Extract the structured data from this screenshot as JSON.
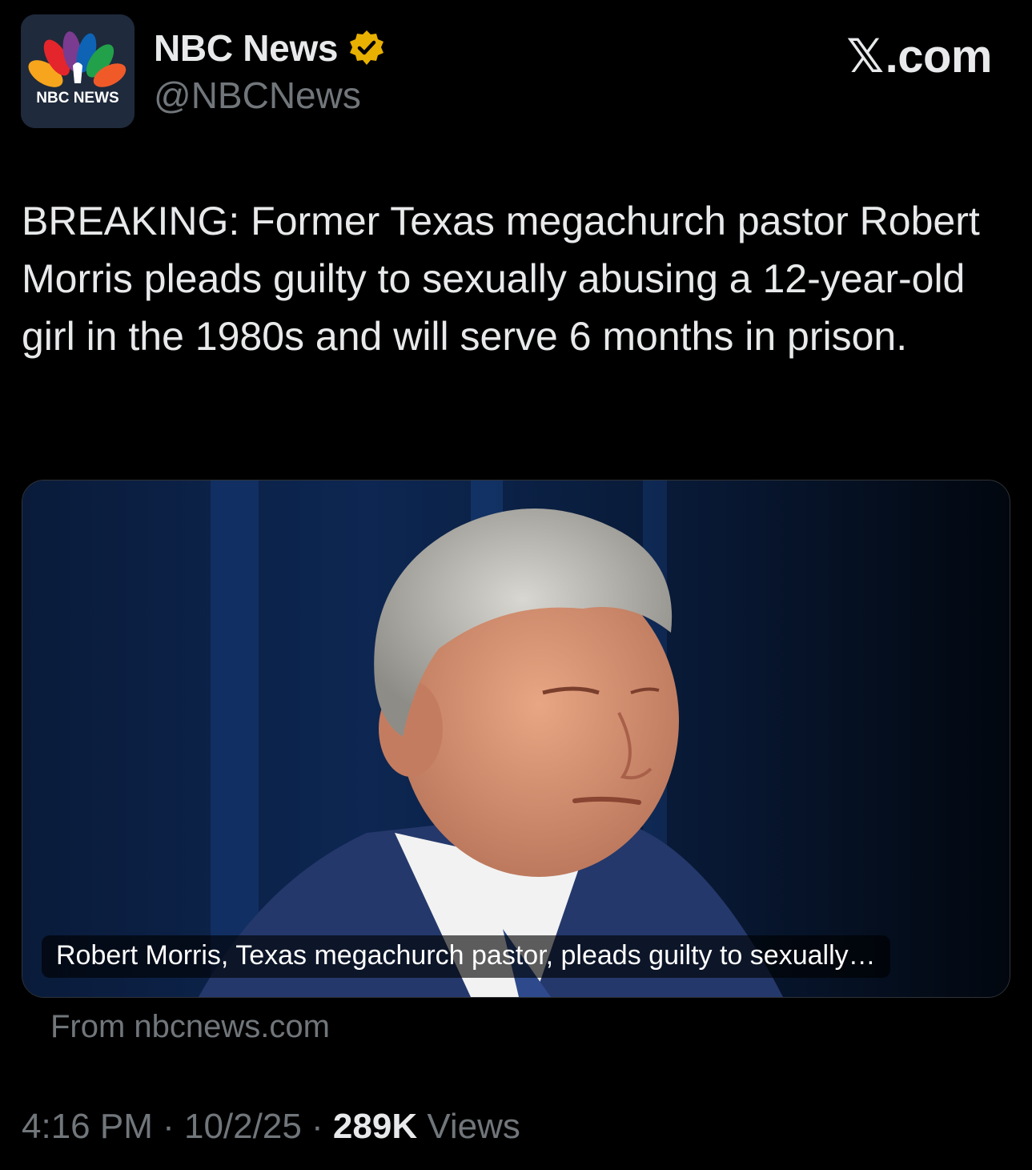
{
  "author": {
    "avatar_label": "NBC NEWS",
    "display_name": "NBC News",
    "handle": "@NBCNews",
    "verified_badge": "verified-badge-icon",
    "badge_color": "#e8b000"
  },
  "site_logo": {
    "x_glyph": "𝕏",
    "text": ".com"
  },
  "tweet": {
    "text": "BREAKING: Former Texas megachurch pastor Robert Morris pleads guilty to sexually abusing a 12-year-old girl in the 1980s and will serve 6 months in prison."
  },
  "link_card": {
    "caption": "Robert Morris, Texas megachurch pastor, pleads guilty to sexually…",
    "source": "From nbcnews.com"
  },
  "meta": {
    "time": "4:16 PM",
    "separator": " · ",
    "date": "10/2/25",
    "views_count": "289K",
    "views_label": " Views"
  },
  "colors": {
    "background": "#000000",
    "primary_text": "#e7e9ea",
    "secondary_text": "#71767b"
  }
}
